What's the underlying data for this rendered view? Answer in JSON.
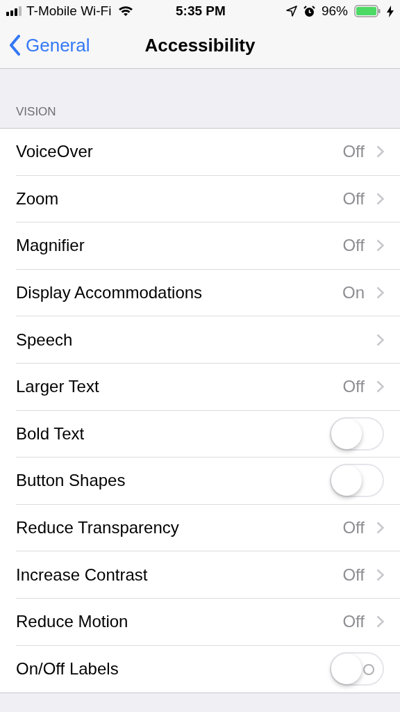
{
  "status_bar": {
    "carrier": "T-Mobile Wi-Fi",
    "time": "5:35 PM",
    "battery": "96%"
  },
  "nav": {
    "back": "General",
    "title": "Accessibility"
  },
  "section": {
    "header": "VISION",
    "rows": [
      {
        "kind": "link",
        "label": "VoiceOver",
        "value": "Off"
      },
      {
        "kind": "link",
        "label": "Zoom",
        "value": "Off"
      },
      {
        "kind": "link",
        "label": "Magnifier",
        "value": "Off"
      },
      {
        "kind": "link",
        "label": "Display Accommodations",
        "value": "On"
      },
      {
        "kind": "link",
        "label": "Speech"
      },
      {
        "kind": "link",
        "label": "Larger Text",
        "value": "Off"
      },
      {
        "kind": "toggle",
        "label": "Bold Text",
        "on": false,
        "shows_label": false
      },
      {
        "kind": "toggle",
        "label": "Button Shapes",
        "on": false,
        "shows_label": false
      },
      {
        "kind": "link",
        "label": "Reduce Transparency",
        "value": "Off"
      },
      {
        "kind": "link",
        "label": "Increase Contrast",
        "value": "Off"
      },
      {
        "kind": "link",
        "label": "Reduce Motion",
        "value": "Off"
      },
      {
        "kind": "toggle",
        "label": "On/Off Labels",
        "on": false,
        "shows_label": true
      }
    ]
  }
}
